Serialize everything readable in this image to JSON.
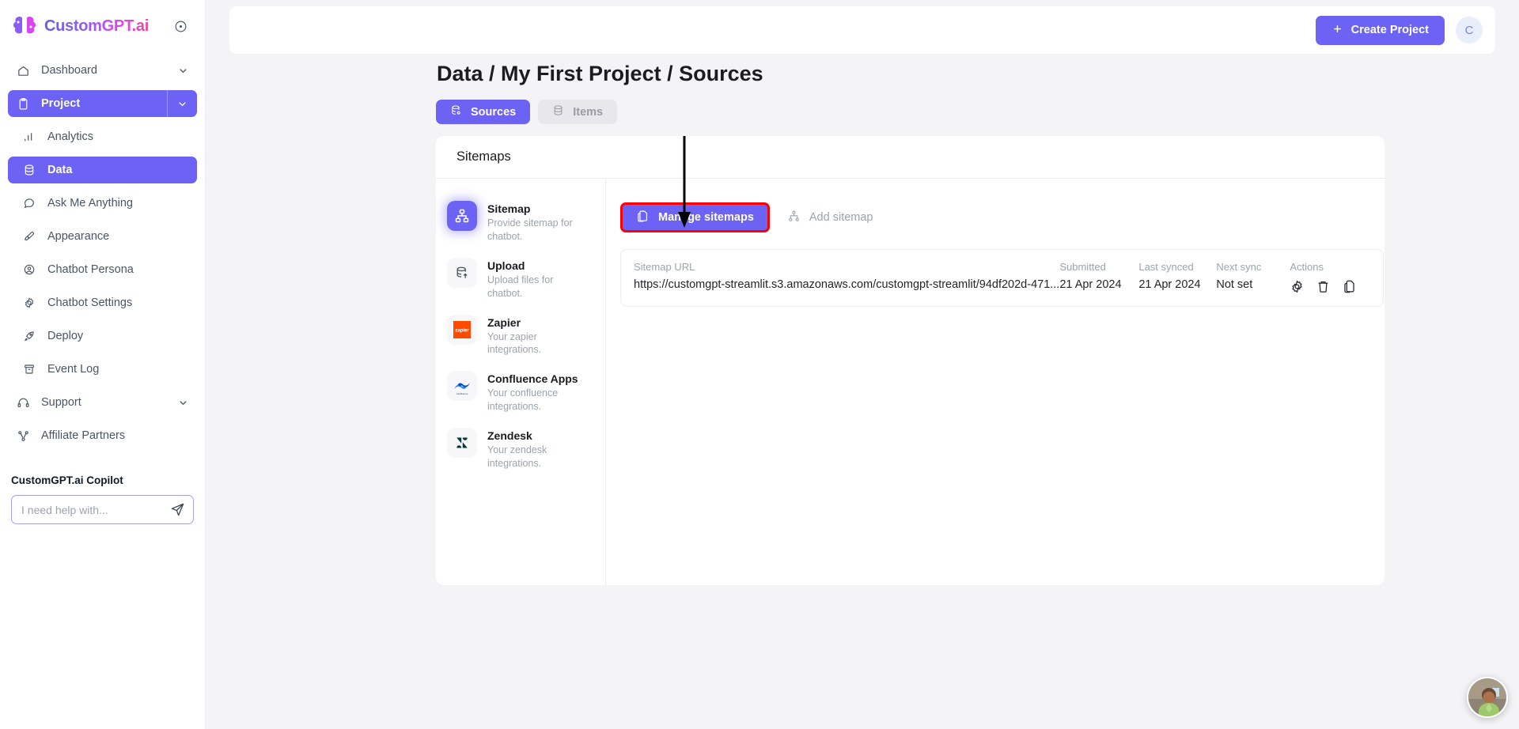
{
  "brand": {
    "name": "CustomGPT.ai",
    "collapse_icon": "collapse-circle-icon"
  },
  "sidebar": {
    "items": [
      {
        "label": "Dashboard",
        "icon": "home-icon",
        "state": "default",
        "chevron": true,
        "sub": false
      },
      {
        "label": "Project",
        "icon": "clipboard-icon",
        "state": "project",
        "chevron": true,
        "sub": false
      },
      {
        "label": "Analytics",
        "icon": "bar-chart-icon",
        "state": "default",
        "chevron": false,
        "sub": true
      },
      {
        "label": "Data",
        "icon": "database-icon",
        "state": "active",
        "chevron": false,
        "sub": true
      },
      {
        "label": "Ask Me Anything",
        "icon": "chat-bubble-icon",
        "state": "default",
        "chevron": false,
        "sub": true
      },
      {
        "label": "Appearance",
        "icon": "paintbrush-icon",
        "state": "default",
        "chevron": false,
        "sub": true
      },
      {
        "label": "Chatbot Persona",
        "icon": "user-circle-icon",
        "state": "default",
        "chevron": false,
        "sub": true
      },
      {
        "label": "Chatbot Settings",
        "icon": "gear-icon",
        "state": "default",
        "chevron": false,
        "sub": true
      },
      {
        "label": "Deploy",
        "icon": "rocket-icon",
        "state": "default",
        "chevron": false,
        "sub": true
      },
      {
        "label": "Event Log",
        "icon": "archive-icon",
        "state": "default",
        "chevron": false,
        "sub": true
      },
      {
        "label": "Support",
        "icon": "headset-icon",
        "state": "default",
        "chevron": true,
        "sub": false
      },
      {
        "label": "Affiliate Partners",
        "icon": "share-nodes-icon",
        "state": "default",
        "chevron": false,
        "sub": false
      }
    ]
  },
  "copilot": {
    "title": "CustomGPT.ai Copilot",
    "placeholder": "I need help with...",
    "value": "",
    "send_icon": "send-paper-plane-icon"
  },
  "topbar": {
    "create_label": "Create Project",
    "plus_icon": "plus-icon",
    "avatar_initial": "C"
  },
  "page": {
    "title": "Data / My First Project / Sources"
  },
  "tabs": [
    {
      "label": "Sources",
      "icon": "database-gear-icon",
      "active": true
    },
    {
      "label": "Items",
      "icon": "database-icon",
      "active": false
    }
  ],
  "card": {
    "heading": "Sitemaps"
  },
  "sources": [
    {
      "name": "Sitemap",
      "desc": "Provide sitemap for chatbot.",
      "icon": "sitemap-icon",
      "selected": true
    },
    {
      "name": "Upload",
      "desc": "Upload files for chatbot.",
      "icon": "database-upload-icon",
      "selected": false
    },
    {
      "name": "Zapier",
      "desc": "Your zapier integrations.",
      "icon": "zapier-logo-icon",
      "selected": false
    },
    {
      "name": "Confluence Apps",
      "desc": "Your confluence integrations.",
      "icon": "confluence-logo-icon",
      "selected": false
    },
    {
      "name": "Zendesk",
      "desc": "Your zendesk integrations.",
      "icon": "zendesk-logo-icon",
      "selected": false
    }
  ],
  "panel": {
    "manage_label": "Manage sitemaps",
    "manage_icon": "copy-files-icon",
    "add_label": "Add sitemap",
    "add_icon": "sitemap-icon",
    "highlight_color": "#ff0000",
    "accent_color": "#6c63f5"
  },
  "table": {
    "headers": {
      "url": "Sitemap URL",
      "submitted": "Submitted",
      "last_synced": "Last synced",
      "next_sync": "Next sync",
      "actions": "Actions"
    },
    "rows": [
      {
        "url": "https://customgpt-streamlit.s3.amazonaws.com/customgpt-streamlit/94df202d-471...",
        "submitted": "21 Apr 2024",
        "last_synced": "21 Apr 2024",
        "next_sync": "Not set",
        "actions": [
          "gear-icon",
          "trash-icon",
          "copy-icon"
        ]
      }
    ]
  },
  "annotation": {
    "arrow": "down-arrow-pointing-to-manage-sitemaps"
  },
  "chat_widget": {
    "icon": "support-agent-avatar"
  }
}
